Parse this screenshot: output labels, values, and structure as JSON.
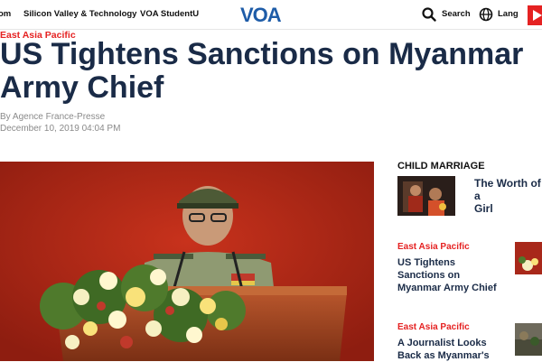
{
  "nav": {
    "items": [
      "om",
      "Silicon Valley & Technology",
      "VOA StudentU"
    ],
    "logo_text": "VOA",
    "search_label": "Search",
    "lang_label": "Lang",
    "live_icon": "play-icon"
  },
  "article": {
    "category": "East Asia Pacific",
    "headline_line1": "US Tightens Sanctions on Myanmar",
    "headline_line2": "Army Chief",
    "byline": "By Agence France-Presse",
    "date": "December 10, 2019 04:04 PM"
  },
  "sidebar": {
    "section_title": "CHILD MARRIAGE",
    "featured": {
      "title_line1": "The Worth of a",
      "title_line2": "Girl"
    },
    "stories": [
      {
        "category": "East Asia Pacific",
        "title_lines": [
          "US Tightens",
          "Sanctions on",
          "Myanmar Army Chief"
        ]
      },
      {
        "category": "East Asia Pacific",
        "title_lines": [
          "A Journalist Looks",
          "Back as Myanmar's"
        ]
      }
    ]
  },
  "colors": {
    "brand_blue": "#1e5ca8",
    "accent_red": "#e52222",
    "headline_navy": "#1a2b47"
  }
}
